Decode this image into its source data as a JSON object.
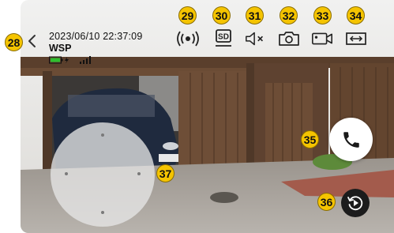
{
  "viewer": {
    "timestamp": "2023/06/10 22:37:09",
    "camera_name": "WSP",
    "battery_icon": "battery-charging-icon",
    "signal_icon": "signal-bars-icon"
  },
  "toolbar": {
    "items": [
      {
        "icon": "audio-wave-icon",
        "callout": "29"
      },
      {
        "icon": "sd-card-icon",
        "label": "SD",
        "callout": "30"
      },
      {
        "icon": "speaker-mute-icon",
        "callout": "31"
      },
      {
        "icon": "camera-snapshot-icon",
        "callout": "32"
      },
      {
        "icon": "video-record-icon",
        "callout": "33"
      },
      {
        "icon": "fit-width-icon",
        "callout": "34"
      }
    ]
  },
  "controls": {
    "back": {
      "icon": "chevron-left-icon",
      "callout": "28"
    },
    "call": {
      "icon": "phone-icon",
      "callout": "35"
    },
    "replay": {
      "icon": "replay-icon",
      "callout": "36"
    },
    "ptz": {
      "callout": "37"
    }
  },
  "colors": {
    "callout_fill": "#f5c400",
    "call_icon": "#1a1a1a",
    "battery_green": "#2fbf2f"
  }
}
